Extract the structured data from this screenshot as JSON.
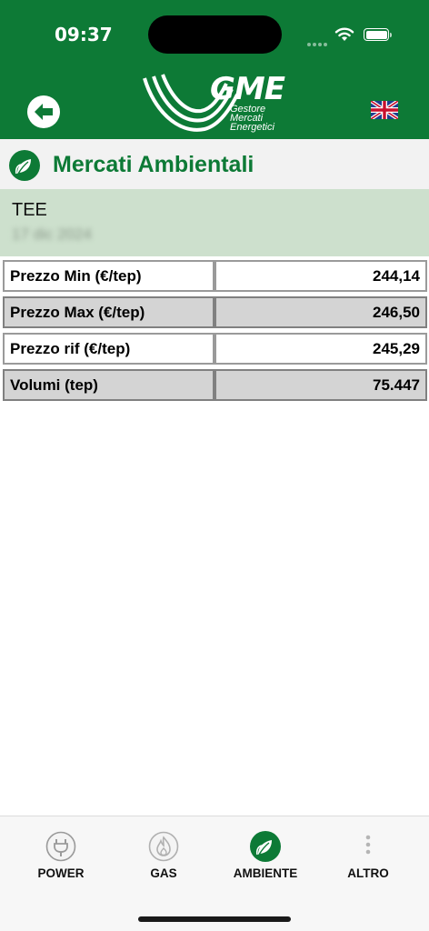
{
  "status_bar": {
    "time": "09:37"
  },
  "header": {
    "logo_title": "GME",
    "logo_subtitle": [
      "Gestore",
      "Mercati",
      "Energetici"
    ]
  },
  "section": {
    "title": "Mercati Ambientali",
    "icon": "leaf-icon"
  },
  "market": {
    "name": "TEE",
    "date": "17 dic 2024"
  },
  "table": {
    "rows": [
      {
        "label": "Prezzo Min (€/tep)",
        "value": "244,14"
      },
      {
        "label": "Prezzo Max (€/tep)",
        "value": "246,50"
      },
      {
        "label": "Prezzo rif (€/tep)",
        "value": "245,29"
      },
      {
        "label": "Volumi (tep)",
        "value": "75.447"
      }
    ]
  },
  "tabs": [
    {
      "label": "POWER",
      "icon": "plug-icon"
    },
    {
      "label": "GAS",
      "icon": "flame-icon"
    },
    {
      "label": "AMBIENTE",
      "icon": "leaf-icon",
      "active": true
    },
    {
      "label": "ALTRO",
      "icon": "more-icon"
    }
  ],
  "colors": {
    "brand": "#0d7a36",
    "market_bg": "#cde0cd",
    "row_shade": "#d4d4d4"
  }
}
